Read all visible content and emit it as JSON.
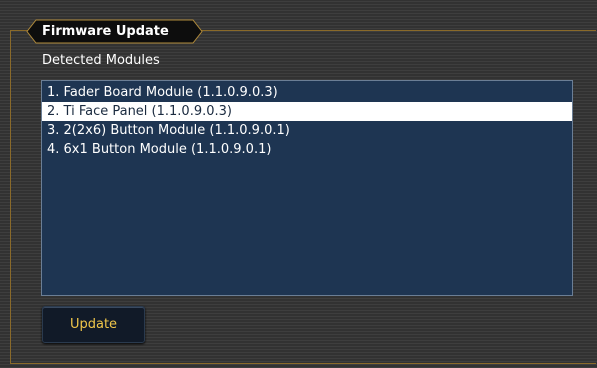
{
  "tab": {
    "title": "Firmware Update"
  },
  "section": {
    "label": "Detected Modules"
  },
  "modules": [
    {
      "label": "1. Fader Board Module (1.1.0.9.0.3)",
      "selected": false
    },
    {
      "label": "2. Ti Face Panel (1.1.0.9.0.3)",
      "selected": true
    },
    {
      "label": "3. 2(2x6) Button Module (1.1.0.9.0.1)",
      "selected": false
    },
    {
      "label": "4. 6x1 Button Module (1.1.0.9.0.1)",
      "selected": false
    }
  ],
  "actions": {
    "update_label": "Update"
  },
  "colors": {
    "frame_accent": "#8a6a2a",
    "list_background": "#1e3552",
    "selection_background": "#ffffff",
    "button_text": "#f0c64a"
  }
}
